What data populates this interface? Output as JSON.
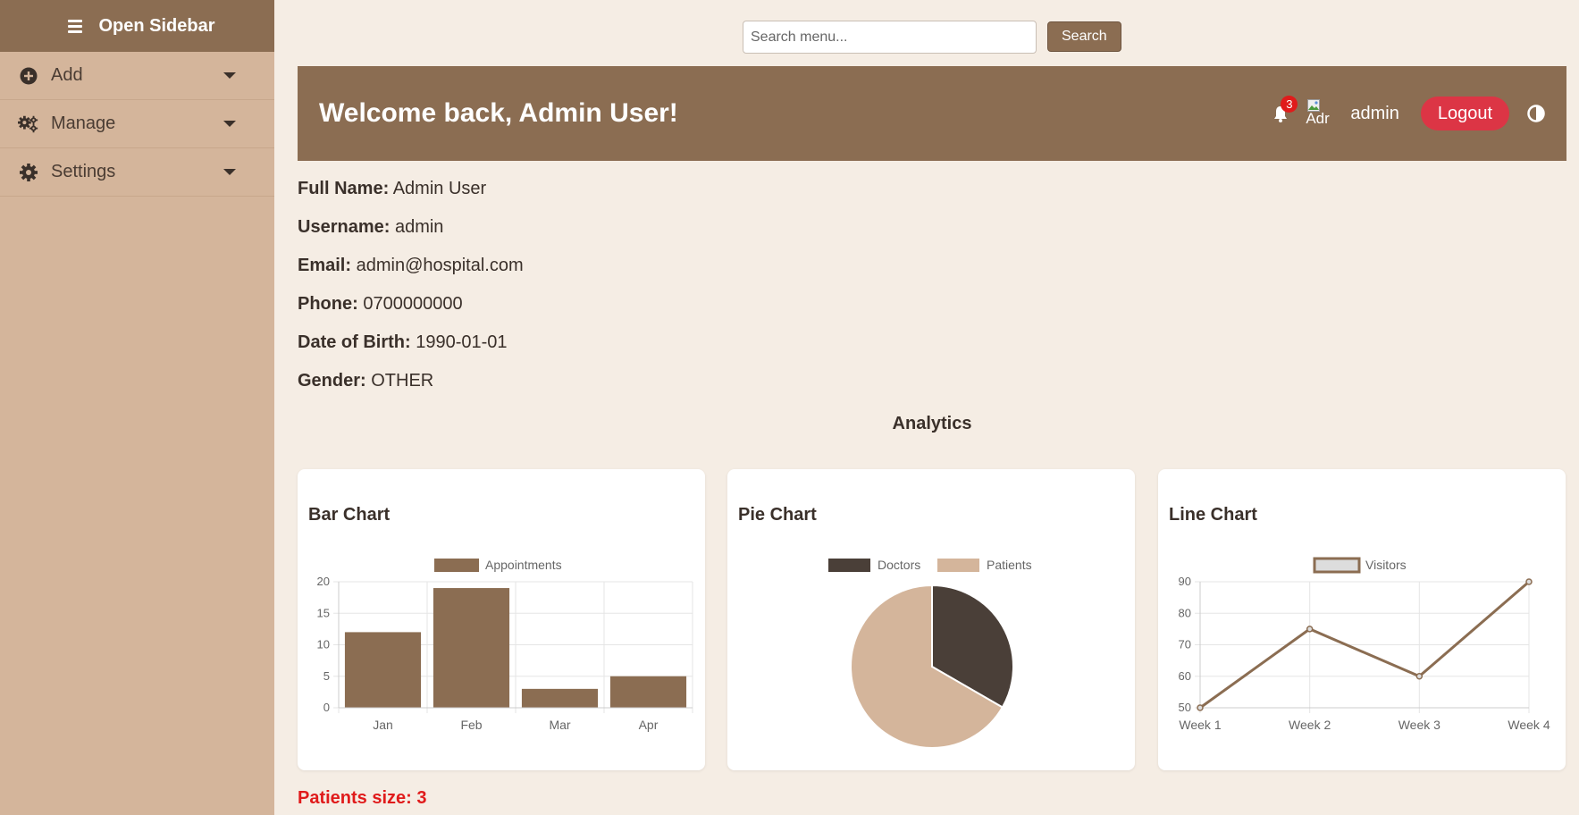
{
  "sidebar": {
    "title": "Open Sidebar",
    "items": [
      {
        "label": "Add",
        "icon": "plus-circle-icon"
      },
      {
        "label": "Manage",
        "icon": "cogs-icon"
      },
      {
        "label": "Settings",
        "icon": "gear-icon"
      }
    ]
  },
  "search": {
    "placeholder": "Search menu...",
    "value": "",
    "button": "Search"
  },
  "header": {
    "welcome": "Welcome back, Admin User!",
    "notification_count": "3",
    "avatar_alt": "Adr",
    "username": "admin",
    "logout": "Logout"
  },
  "profile": [
    {
      "label": "Full Name:",
      "value": "Admin User"
    },
    {
      "label": "Username:",
      "value": "admin"
    },
    {
      "label": "Email:",
      "value": "admin@hospital.com"
    },
    {
      "label": "Phone:",
      "value": "0700000000"
    },
    {
      "label": "Date of Birth:",
      "value": "1990-01-01"
    },
    {
      "label": "Gender:",
      "value": "OTHER"
    }
  ],
  "analytics_title": "Analytics",
  "colors": {
    "brand": "#8b6d52",
    "dark": "#4a3f38",
    "light": "#d4b59b",
    "danger": "#dc3545"
  },
  "chart_data": [
    {
      "type": "bar",
      "title": "Bar Chart",
      "categories": [
        "Jan",
        "Feb",
        "Mar",
        "Apr"
      ],
      "series": [
        {
          "name": "Appointments",
          "values": [
            12,
            19,
            3,
            5
          ]
        }
      ],
      "ylim": [
        0,
        20
      ],
      "yticks": [
        0,
        5,
        10,
        15,
        20
      ],
      "legend": "top",
      "grid": true
    },
    {
      "type": "pie",
      "title": "Pie Chart",
      "categories": [
        "Doctors",
        "Patients"
      ],
      "values": [
        1,
        2
      ],
      "colors": [
        "#4a3f38",
        "#d4b59b"
      ],
      "legend": "top"
    },
    {
      "type": "line",
      "title": "Line Chart",
      "categories": [
        "Week 1",
        "Week 2",
        "Week 3",
        "Week 4"
      ],
      "series": [
        {
          "name": "Visitors",
          "values": [
            50,
            75,
            60,
            90
          ]
        }
      ],
      "ylim": [
        50,
        90
      ],
      "yticks": [
        50,
        60,
        70,
        80,
        90
      ],
      "legend": "top",
      "grid": true
    }
  ],
  "patients_size": "Patients size: 3"
}
